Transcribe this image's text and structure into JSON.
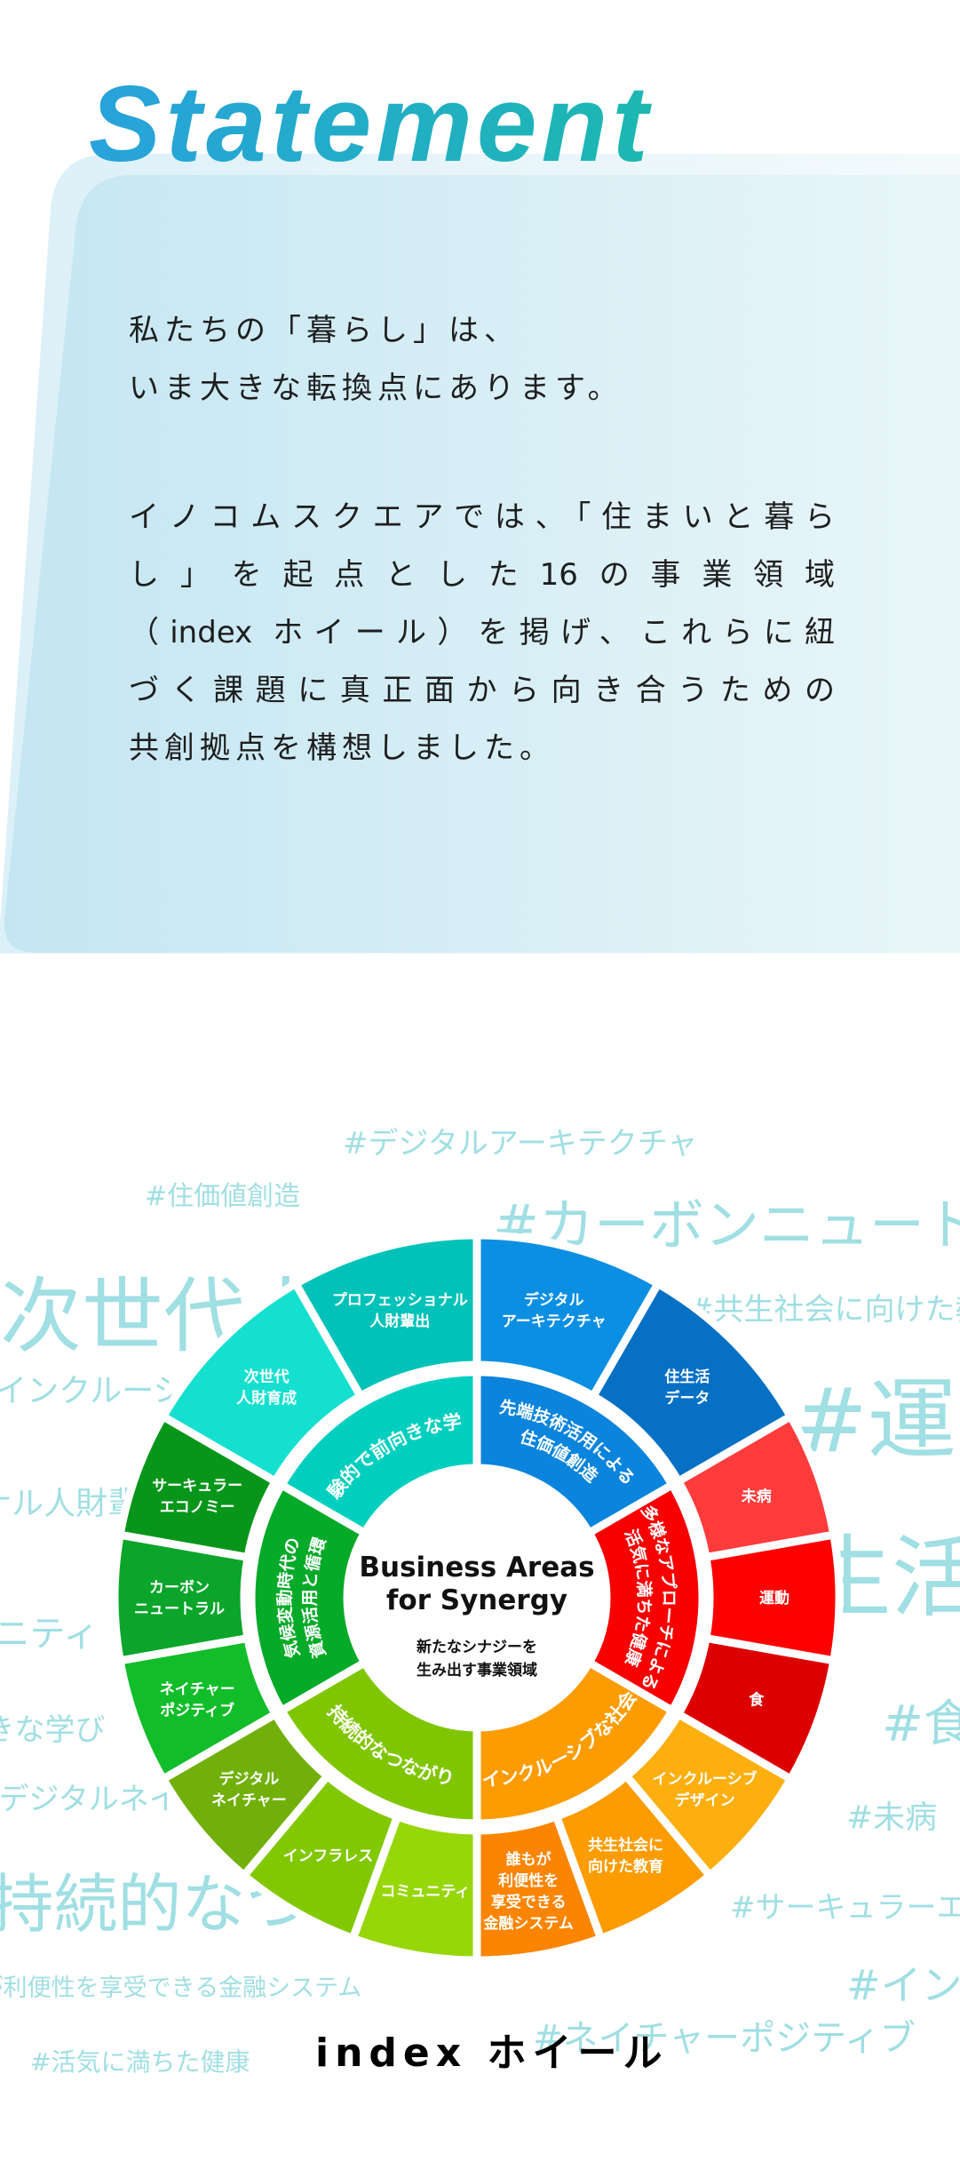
{
  "statement": {
    "heading": "Statement",
    "paragraph1": [
      "私たちの「暮らし」は、",
      "いま大きな転換点にあります。"
    ],
    "paragraph2": [
      "イノコムスクエアでは、「住まいと暮ら",
      "し」を起点とした16の事業領域",
      "（index ホイール）を掲げ、これらに紐",
      "づく課題に真正面から向き合うための",
      "共創拠点を構想しました。"
    ]
  },
  "background_tags": [
    "#デジタルアーキテクチャ",
    "#住価値創造",
    "#カーボンニュートラル",
    "次世代人財育成",
    "#共生社会に向けた教育",
    "#インクルーシブデザイン",
    "#運動",
    "#プロフェッショナル人財輩出",
    "#住生活データ",
    "#コミュニティ",
    "#食",
    "#実験的で前向きな学び",
    "#デジタルネイチャー",
    "#未病",
    "#持続的なつながり",
    "#サーキュラーエコノミー",
    "#誰もが利便性を享受できる金融システム",
    "#インクルーシブな社会",
    "#ネイチャーポジティブ",
    "#活気に満ちた健康"
  ],
  "wheel": {
    "center_title": [
      "Business Areas",
      "for Synergy"
    ],
    "center_subtitle": [
      "新たなシナジーを",
      "生み出す事業領域"
    ],
    "groups": [
      {
        "label": [
          "先端技術活用による",
          "住価値創造"
        ],
        "color": "#0a84dc",
        "direction": "cw",
        "items": [
          {
            "label": [
              "デジタル",
              "アーキテクチャ"
            ],
            "color": "#0b8fe2"
          },
          {
            "label": [
              "住生活",
              "データ"
            ],
            "color": "#0670c4"
          }
        ]
      },
      {
        "label": [
          "多様なアプローチによる",
          "活気に満ちた健康"
        ],
        "color": "#f80000",
        "direction": "cw",
        "items": [
          {
            "label": [
              "未病"
            ],
            "color": "#ff3b3b"
          },
          {
            "label": [
              "運動"
            ],
            "color": "#ff0000"
          },
          {
            "label": [
              "食"
            ],
            "color": "#dc0000"
          }
        ]
      },
      {
        "label": [
          "インクルーシブな社会"
        ],
        "color": "#fc9c00",
        "direction": "ccw",
        "items": [
          {
            "label": [
              "インクルーシブ",
              "デザイン"
            ],
            "color": "#fdaf10"
          },
          {
            "label": [
              "共生社会に",
              "向けた教育"
            ],
            "color": "#fc9c00"
          },
          {
            "label": [
              "誰もが",
              "利便性を",
              "享受できる",
              "金融システム"
            ],
            "color": "#fb8500"
          }
        ]
      },
      {
        "label": [
          "持続的なつながり"
        ],
        "color": "#80c600",
        "direction": "ccw",
        "items": [
          {
            "label": [
              "コミュニティ"
            ],
            "color": "#97d70a"
          },
          {
            "label": [
              "インフラレス"
            ],
            "color": "#82c800"
          },
          {
            "label": [
              "デジタル",
              "ネイチャー"
            ],
            "color": "#71b00a"
          }
        ]
      },
      {
        "label": [
          "気候変動時代の",
          "資源活用と循環"
        ],
        "color": "#05aa28",
        "direction": "cw",
        "items": [
          {
            "label": [
              "ネイチャー",
              "ポジティブ"
            ],
            "color": "#12bd2a"
          },
          {
            "label": [
              "カーボン",
              "ニュートラル"
            ],
            "color": "#0aa52a"
          },
          {
            "label": [
              "サーキュラー",
              "エコノミー"
            ],
            "color": "#07961a"
          }
        ]
      },
      {
        "label": [
          "実験的で前向きな学び"
        ],
        "color": "#00cfc0",
        "direction": "cw",
        "items": [
          {
            "label": [
              "次世代",
              "人財育成"
            ],
            "color": "#15e0d0"
          },
          {
            "label": [
              "プロフェッショナル",
              "人財輩出"
            ],
            "color": "#00c2b8"
          }
        ]
      }
    ]
  },
  "index_title": "index ホイール",
  "colors": {
    "heading_start": "#28a2dc",
    "heading_end": "#1cb8b0",
    "tag": "#a0dfe3",
    "text": "#1e1e1e"
  }
}
